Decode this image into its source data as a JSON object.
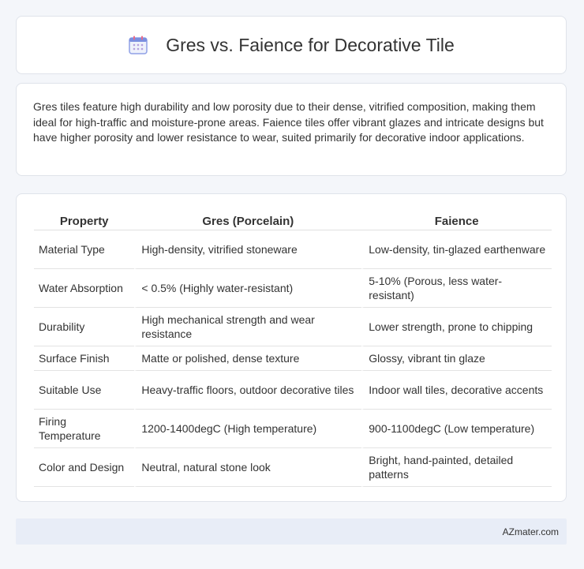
{
  "header": {
    "title": "Gres vs. Faience for Decorative Tile",
    "icon": "calendar-icon",
    "icon_color": "#7b8fe0"
  },
  "intro": {
    "text": "Gres tiles feature high durability and low porosity due to their dense, vitrified composition, making them ideal for high-traffic and moisture-prone areas. Faience tiles offer vibrant glazes and intricate designs but have higher porosity and lower resistance to wear, suited primarily for decorative indoor applications."
  },
  "table": {
    "headers": [
      "Property",
      "Gres (Porcelain)",
      "Faience"
    ],
    "rows": [
      [
        "Material Type",
        "High-density, vitrified stoneware",
        "Low-density, tin-glazed earthenware"
      ],
      [
        "Water Absorption",
        "< 0.5% (Highly water-resistant)",
        "5-10% (Porous, less water-resistant)"
      ],
      [
        "Durability",
        "High mechanical strength and wear resistance",
        "Lower strength, prone to chipping"
      ],
      [
        "Surface Finish",
        "Matte or polished, dense texture",
        "Glossy, vibrant tin glaze"
      ],
      [
        "Suitable Use",
        "Heavy-traffic floors, outdoor decorative tiles",
        "Indoor wall tiles, decorative accents"
      ],
      [
        "Firing Temperature",
        "1200-1400degC (High temperature)",
        "900-1100degC (Low temperature)"
      ],
      [
        "Color and Design",
        "Neutral, natural stone look",
        "Bright, hand-painted, detailed patterns"
      ]
    ]
  },
  "footer": {
    "brand": "AZmater.com",
    "bg_color": "#e8edf7"
  }
}
